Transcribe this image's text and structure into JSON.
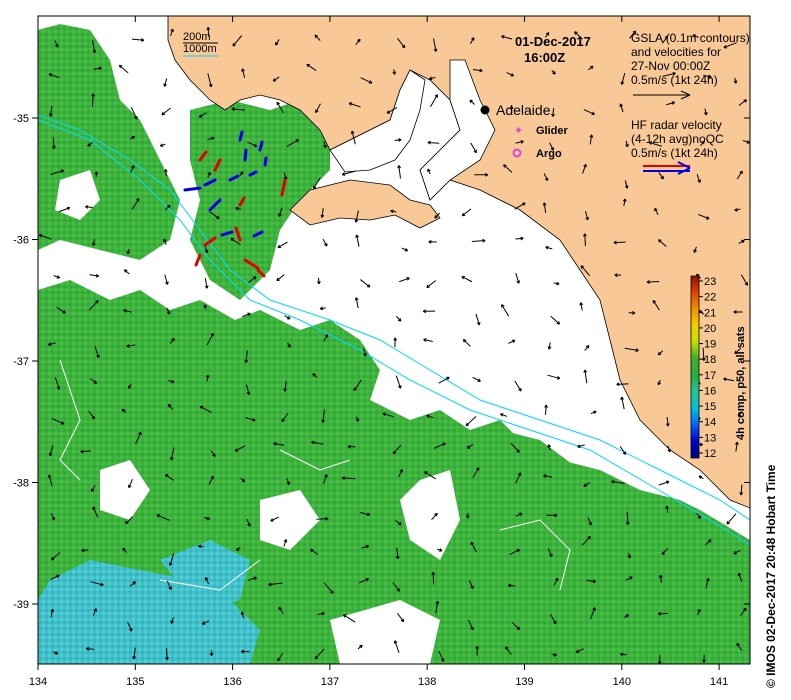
{
  "title": {
    "date": "01-Dec-2017",
    "time": "16:00Z"
  },
  "scale": {
    "depth1": "200m",
    "depth2": "1000m"
  },
  "legend": {
    "gsla_line1": "GSLA (0.1m contours)",
    "gsla_line2": "and velocities for",
    "gsla_line3": "27-Nov 00:00Z",
    "gsla_line4": "0.5m/s (1kt 24h)",
    "hf_line1": "HF radar velocity",
    "hf_line2": "(4-12h avg)noQC",
    "hf_line3": "0.5m/s (1kt 24h)",
    "city": "Adelaide",
    "glider": "Glider",
    "argo": "Argo"
  },
  "colorbar": {
    "label": "4h comp, p50, all sats",
    "ticks": [
      "23",
      "22",
      "21",
      "20",
      "19",
      "18",
      "17",
      "16",
      "15",
      "14",
      "13",
      "12"
    ]
  },
  "axes": {
    "x_ticks": [
      "134",
      "135",
      "136",
      "137",
      "138",
      "139",
      "140",
      "141"
    ],
    "y_ticks": [
      "-35",
      "-36",
      "-37",
      "-38",
      "-39"
    ]
  },
  "credit": "© IMOS 02-Dec-2017 20:48 Hobart Time",
  "colors": {
    "land": "#f8c896",
    "sst_green": "#3cb43c",
    "sst_cyan": "#3cc8dc",
    "contour": "#00d8ff",
    "hf_red": "#e00000",
    "hf_blue": "#0000e0"
  }
}
